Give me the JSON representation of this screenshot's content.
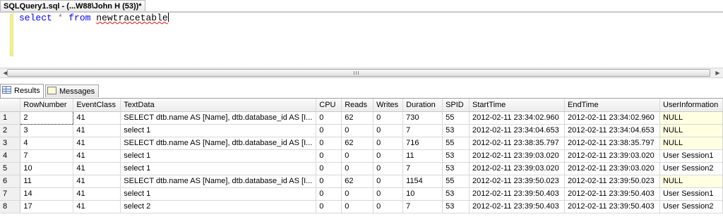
{
  "document_tab": {
    "title": "SQLQuery1.sql - (...W88\\John H (53))*"
  },
  "editor": {
    "keyword_select": "select",
    "star": "*",
    "keyword_from": "from",
    "table_name": "newtracetable"
  },
  "result_tabs": [
    {
      "label": "Results",
      "active": true,
      "icon": "grid-icon"
    },
    {
      "label": "Messages",
      "active": false,
      "icon": "messages-icon"
    }
  ],
  "grid": {
    "columns": [
      "RowNumber",
      "EventClass",
      "TextData",
      "CPU",
      "Reads",
      "Writes",
      "Duration",
      "SPID",
      "StartTime",
      "EndTime",
      "UserInformation"
    ],
    "rows": [
      [
        "1",
        "2",
        "41",
        "SELECT dtb.name AS [Name], dtb.database_id AS [I...",
        "0",
        "62",
        "0",
        "730",
        "55",
        "2012-02-11 23:34:02.960",
        "2012-02-11 23:34:02.960",
        "NULL"
      ],
      [
        "2",
        "3",
        "41",
        "select 1",
        "0",
        "0",
        "0",
        "7",
        "53",
        "2012-02-11 23:34:04.653",
        "2012-02-11 23:34:04.653",
        "NULL"
      ],
      [
        "3",
        "4",
        "41",
        "SELECT dtb.name AS [Name], dtb.database_id AS [I...",
        "0",
        "62",
        "0",
        "716",
        "55",
        "2012-02-11 23:38:35.797",
        "2012-02-11 23:38:35.797",
        "NULL"
      ],
      [
        "4",
        "7",
        "41",
        "select 1",
        "0",
        "0",
        "0",
        "11",
        "53",
        "2012-02-11 23:39:03.020",
        "2012-02-11 23:39:03.020",
        "User Session1"
      ],
      [
        "5",
        "10",
        "41",
        "select 1",
        "0",
        "0",
        "0",
        "7",
        "53",
        "2012-02-11 23:39:03.020",
        "2012-02-11 23:39:03.020",
        "User Session2"
      ],
      [
        "6",
        "11",
        "41",
        "SELECT dtb.name AS [Name], dtb.database_id AS [I...",
        "0",
        "62",
        "0",
        "1154",
        "55",
        "2012-02-11 23:39:50.023",
        "2012-02-11 23:39:50.023",
        "NULL"
      ],
      [
        "7",
        "14",
        "41",
        "select 1",
        "0",
        "0",
        "0",
        "10",
        "53",
        "2012-02-11 23:39:50.403",
        "2012-02-11 23:39:50.403",
        "User Session1"
      ],
      [
        "8",
        "17",
        "41",
        "select 2",
        "0",
        "0",
        "0",
        "7",
        "53",
        "2012-02-11 23:39:50.403",
        "2012-02-11 23:39:50.403",
        "User Session2"
      ]
    ],
    "null_highlight_color": "#ffffe1"
  },
  "colors": {
    "keyword": "#0000ff",
    "operator": "#808080",
    "squiggle": "#e81010"
  }
}
